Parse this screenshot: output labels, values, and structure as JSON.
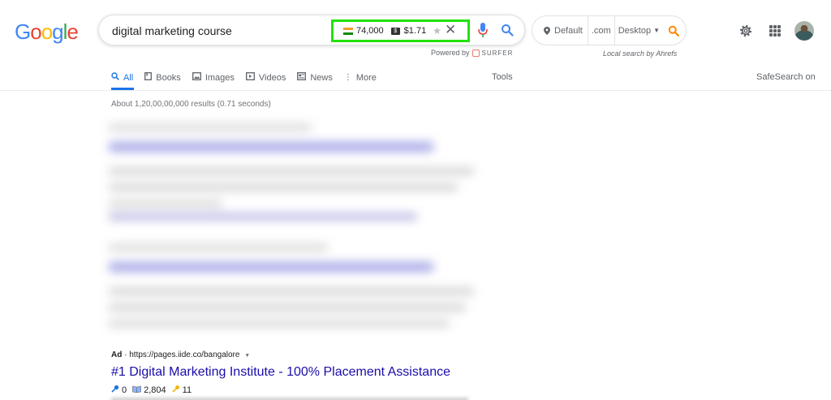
{
  "logo": [
    "G",
    "o",
    "o",
    "g",
    "l",
    "e"
  ],
  "search": {
    "query": "digital marketing course"
  },
  "surfer": {
    "volume": "74,000",
    "cpc": "$1.71",
    "powered_by": "Powered by",
    "brand": "SURFER"
  },
  "ahrefs": {
    "location": "Default",
    "domain": ".com",
    "device": "Desktop",
    "caption": "Local search by Ahrefs"
  },
  "tabs": [
    {
      "label": "All",
      "active": true
    },
    {
      "label": "Books"
    },
    {
      "label": "Images"
    },
    {
      "label": "Videos"
    },
    {
      "label": "News"
    },
    {
      "label": "More"
    }
  ],
  "tools_label": "Tools",
  "safesearch_label": "SafeSearch on",
  "results_stats": "About 1,20,00,00,000 results (0.71 seconds)",
  "ad": {
    "badge": "Ad",
    "url": "https://pages.iide.co/bangalore",
    "title": "#1 Digital Marketing Institute - 100% Placement Assistance",
    "metric_1": "0",
    "metric_2": "2,804",
    "metric_3": "11"
  },
  "colors": {
    "accent": "#1a73e8",
    "link": "#1a0dab",
    "highlight_border": "#22e20c"
  }
}
